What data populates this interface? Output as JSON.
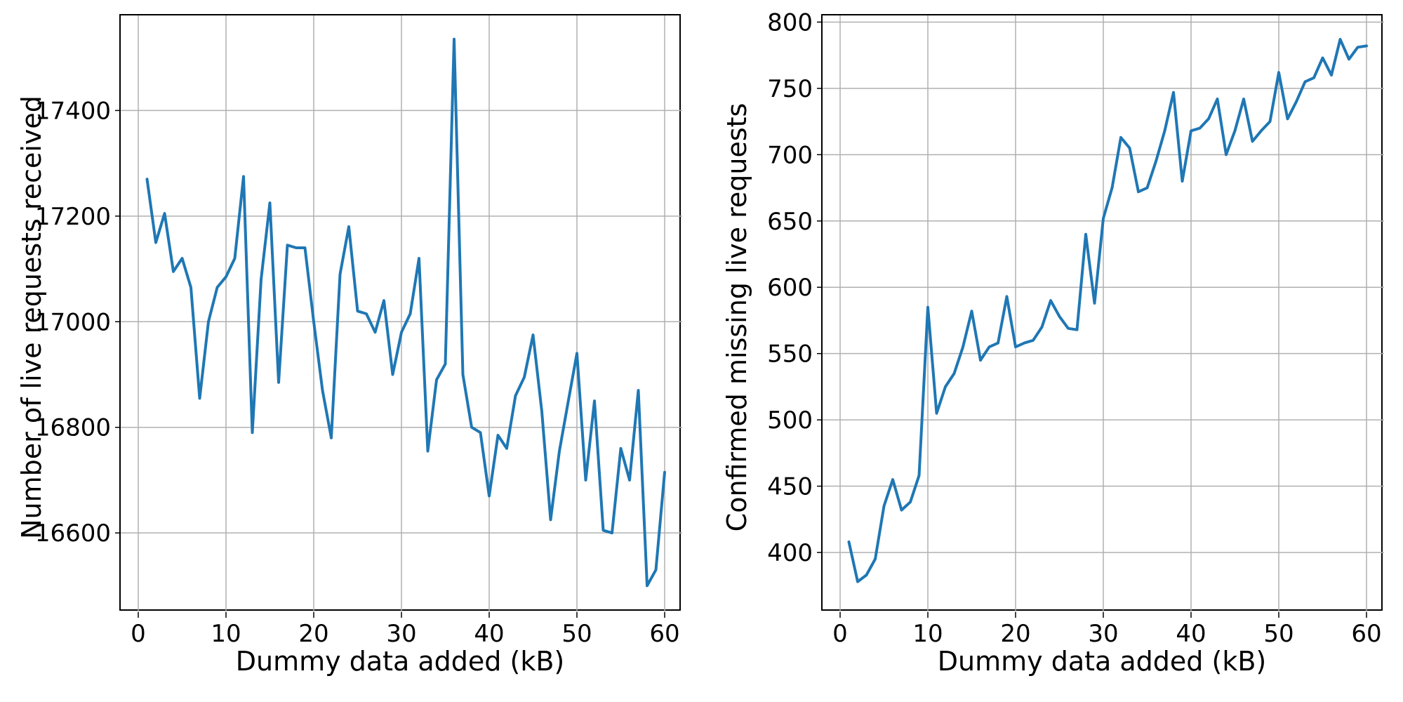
{
  "chart_data": [
    {
      "type": "line",
      "xlabel": "Dummy data added (kB)",
      "ylabel": "Number of live requests received",
      "xlim": [
        -2,
        62
      ],
      "ylim": [
        16450,
        17580
      ],
      "xticks": [
        0,
        10,
        20,
        30,
        40,
        50,
        60
      ],
      "yticks": [
        16600,
        16800,
        17000,
        17200,
        17400
      ],
      "x": [
        1,
        2,
        3,
        4,
        5,
        6,
        7,
        8,
        9,
        10,
        11,
        12,
        13,
        14,
        15,
        16,
        17,
        18,
        19,
        20,
        21,
        22,
        23,
        24,
        25,
        26,
        27,
        28,
        29,
        30,
        31,
        32,
        33,
        34,
        35,
        36,
        37,
        38,
        39,
        40,
        41,
        42,
        43,
        44,
        45,
        46,
        47,
        48,
        49,
        50,
        51,
        52,
        53,
        54,
        55,
        56,
        57,
        58,
        59,
        60
      ],
      "values": [
        17270,
        17150,
        17205,
        17095,
        17120,
        17065,
        16855,
        17000,
        17065,
        17085,
        17120,
        17275,
        16790,
        17080,
        17225,
        16885,
        17145,
        17140,
        17140,
        17000,
        16870,
        16780,
        17090,
        17180,
        17020,
        17015,
        16980,
        17040,
        16900,
        16980,
        17015,
        17120,
        16755,
        16890,
        16920,
        17535,
        16900,
        16800,
        16790,
        16670,
        16785,
        16760,
        16860,
        16895,
        16975,
        16830,
        16625,
        16755,
        16848,
        16940,
        16700,
        16850,
        16605,
        16600,
        16760,
        16700,
        16870,
        16500,
        16530,
        16715
      ],
      "color": "#1f77b4"
    },
    {
      "type": "line",
      "xlabel": "Dummy data added (kB)",
      "ylabel": "Confirmed missing live requests",
      "xlim": [
        -2,
        62
      ],
      "ylim": [
        355,
        805
      ],
      "xticks": [
        0,
        10,
        20,
        30,
        40,
        50,
        60
      ],
      "yticks": [
        400,
        450,
        500,
        550,
        600,
        650,
        700,
        750,
        800
      ],
      "x": [
        1,
        2,
        3,
        4,
        5,
        6,
        7,
        8,
        9,
        10,
        11,
        12,
        13,
        14,
        15,
        16,
        17,
        18,
        19,
        20,
        21,
        22,
        23,
        24,
        25,
        26,
        27,
        28,
        29,
        30,
        31,
        32,
        33,
        34,
        35,
        36,
        37,
        38,
        39,
        40,
        41,
        42,
        43,
        44,
        45,
        46,
        47,
        48,
        49,
        50,
        51,
        52,
        53,
        54,
        55,
        56,
        57,
        58,
        59,
        60
      ],
      "values": [
        408,
        378,
        383,
        395,
        435,
        455,
        432,
        438,
        458,
        585,
        505,
        525,
        535,
        555,
        582,
        545,
        555,
        558,
        593,
        555,
        558,
        560,
        570,
        590,
        578,
        569,
        568,
        640,
        588,
        652,
        675,
        713,
        705,
        672,
        675,
        695,
        718,
        747,
        680,
        718,
        720,
        727,
        742,
        700,
        718,
        742,
        710,
        718,
        725,
        762,
        727,
        740,
        755,
        758,
        773,
        760,
        787,
        772,
        781,
        782
      ],
      "color": "#1f77b4"
    }
  ]
}
